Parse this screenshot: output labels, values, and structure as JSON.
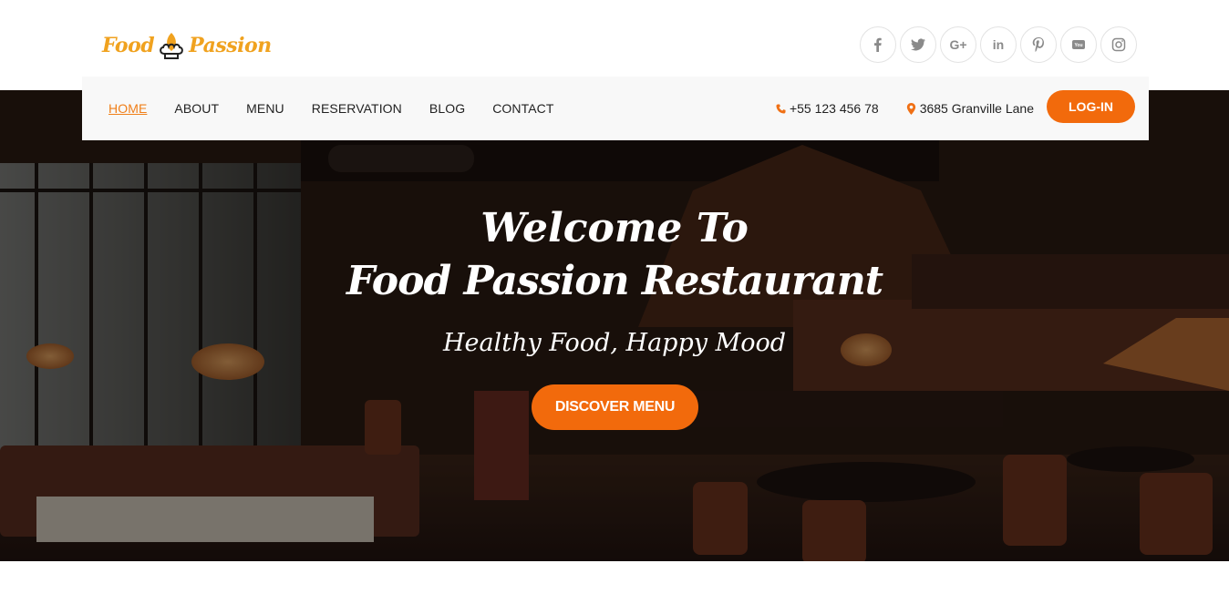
{
  "brand": {
    "logo_left": "Food",
    "logo_right": "Passion",
    "logo_icon": "chef-hat-icon"
  },
  "socials": [
    {
      "name": "facebook",
      "glyph": "f"
    },
    {
      "name": "twitter",
      "glyph": "t"
    },
    {
      "name": "google-plus",
      "glyph": "G+"
    },
    {
      "name": "linkedin",
      "glyph": "in"
    },
    {
      "name": "pinterest",
      "glyph": "P"
    },
    {
      "name": "youtube",
      "glyph": "You"
    },
    {
      "name": "instagram",
      "glyph": "ig"
    }
  ],
  "nav": {
    "items": [
      "HOME",
      "ABOUT",
      "MENU",
      "RESERVATION",
      "BLOG",
      "CONTACT"
    ],
    "active": "HOME",
    "phone": "+55 123 456 78",
    "address": "3685 Granville Lane",
    "login_label": "LOG-IN"
  },
  "hero": {
    "title_line1": "Welcome To",
    "title_line2": "Food Passion Restaurant",
    "tagline": "Healthy Food, Happy Mood",
    "cta_label": "DISCOVER MENU"
  },
  "colors": {
    "accent": "#f26a0c",
    "logo": "#f0a21f",
    "nav_active": "#f07f1a",
    "navbar_bg": "#f8f8f8"
  }
}
